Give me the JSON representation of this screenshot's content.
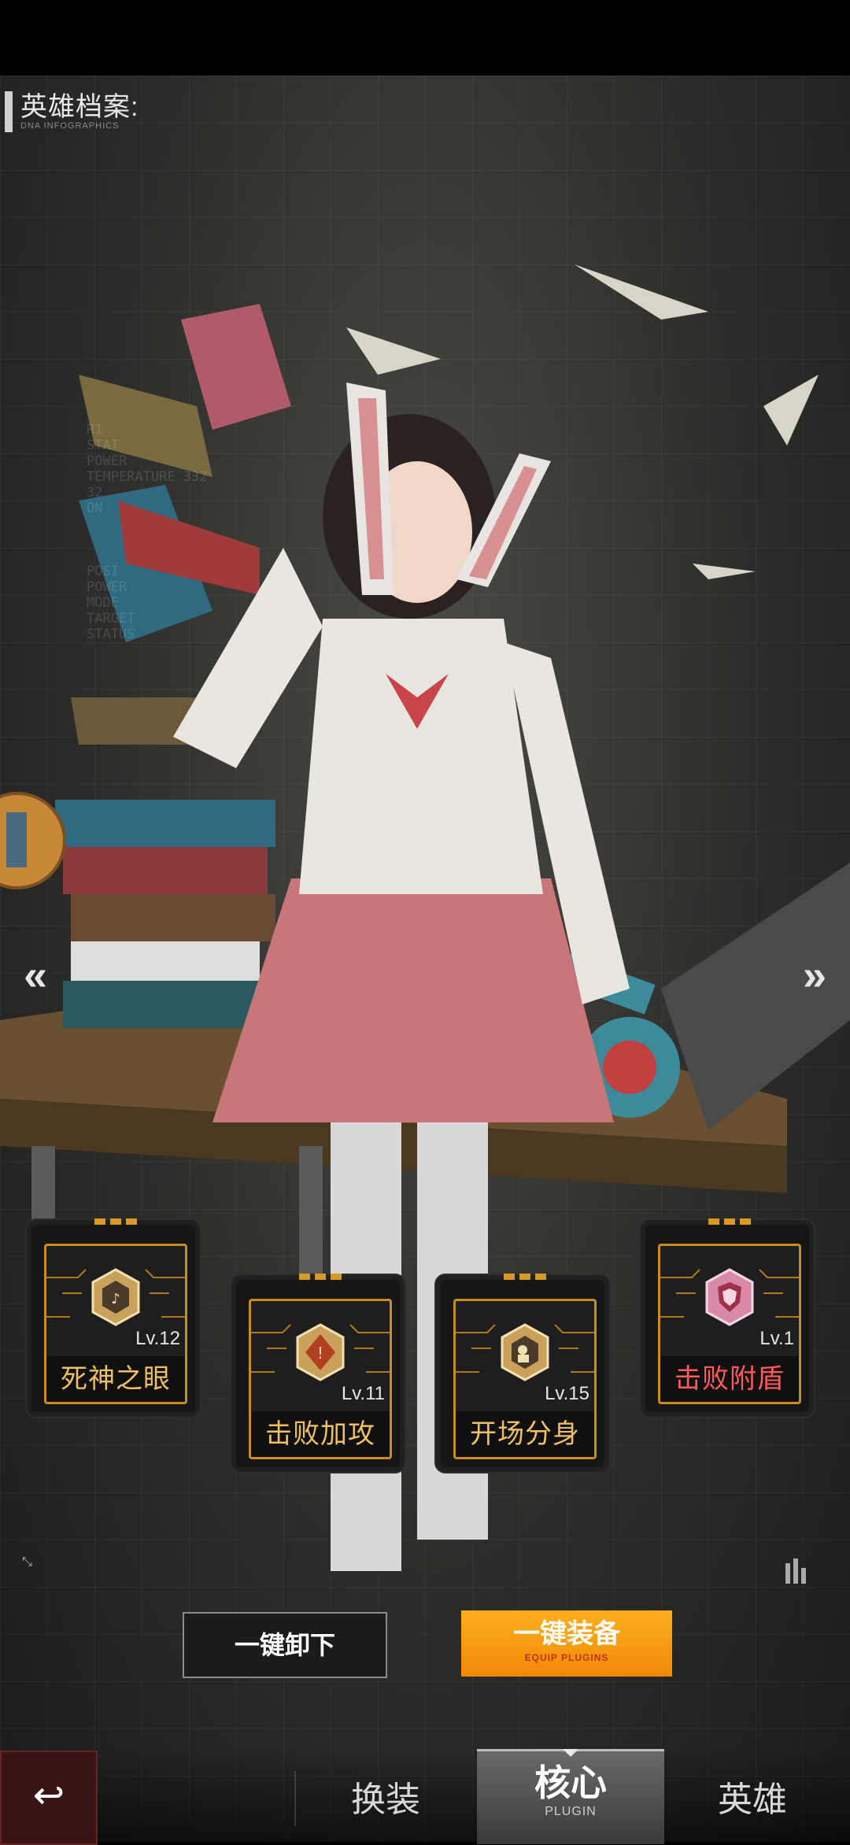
{
  "header": {
    "title": "英雄档案:",
    "subtitle": "DNA INFOGRAPHICS"
  },
  "bg_data": [
    "R1",
    "STAT",
    "POWER",
    "TEMPERATURE 332",
    "32",
    "ON",
    "POSI",
    "POWER",
    "MODE",
    "TARGET",
    "STATUS"
  ],
  "nav_arrows": {
    "left": "«",
    "right": "»"
  },
  "plugins": [
    {
      "name": "死神之眼",
      "level": "Lv.12",
      "color": "#f0c060"
    },
    {
      "name": "击败加攻",
      "level": "Lv.11",
      "color": "#f0c060"
    },
    {
      "name": "开场分身",
      "level": "Lv.15",
      "color": "#f0c060"
    },
    {
      "name": "击败附盾",
      "level": "Lv.1",
      "color": "#ff5a5a"
    }
  ],
  "actions": {
    "unequip_label": "一键卸下",
    "equip_label": "一键装备",
    "equip_sub": "EQUIP PLUGINS"
  },
  "bottom_nav": {
    "back_icon": "↩",
    "tabs": [
      {
        "label": "换装"
      },
      {
        "label": "核心",
        "sub": "PLUGIN",
        "active": true
      },
      {
        "label": "英雄"
      }
    ]
  }
}
